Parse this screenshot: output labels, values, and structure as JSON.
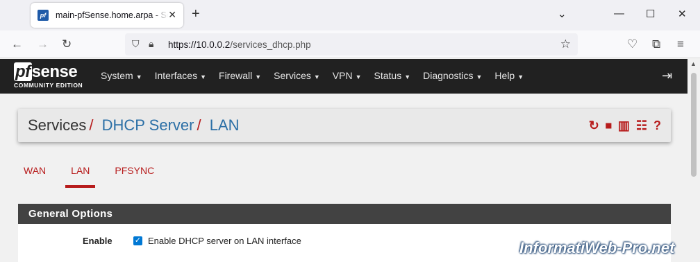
{
  "browser": {
    "tab_title": "main-pfSense.home.arpa - Services: DHCP Server: LAN",
    "favicon_text": "pf",
    "url_host": "https://10.0.0.2",
    "url_path": "/services_dhcp.php"
  },
  "header": {
    "logo_main": "sense",
    "logo_prefix": "pf",
    "logo_sub": "COMMUNITY EDITION",
    "menu": [
      "System",
      "Interfaces",
      "Firewall",
      "Services",
      "VPN",
      "Status",
      "Diagnostics",
      "Help"
    ]
  },
  "breadcrumb": {
    "root": "Services",
    "level1": "DHCP Server",
    "level2": "LAN",
    "separator": "/"
  },
  "tabs": [
    "WAN",
    "LAN",
    "PFSYNC"
  ],
  "active_tab": "LAN",
  "panel": {
    "title": "General Options",
    "enable_label": "Enable",
    "enable_checkbox_label": "Enable DHCP server on LAN interface",
    "enable_checked": true
  },
  "watermark": "InformatiWeb-Pro.net",
  "colors": {
    "accent": "#b71c1c",
    "link": "#2b6fa6",
    "header_bg": "#212121",
    "panel_head": "#424242"
  }
}
